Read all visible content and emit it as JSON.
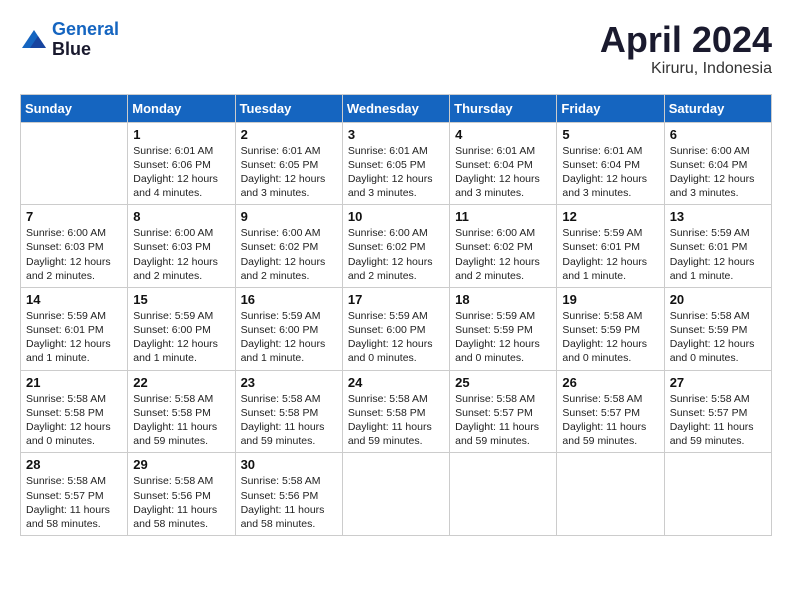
{
  "header": {
    "logo": {
      "line1": "General",
      "line2": "Blue"
    },
    "month": "April 2024",
    "location": "Kiruru, Indonesia"
  },
  "weekdays": [
    "Sunday",
    "Monday",
    "Tuesday",
    "Wednesday",
    "Thursday",
    "Friday",
    "Saturday"
  ],
  "weeks": [
    [
      {
        "day": "",
        "info": ""
      },
      {
        "day": "1",
        "info": "Sunrise: 6:01 AM\nSunset: 6:06 PM\nDaylight: 12 hours\nand 4 minutes."
      },
      {
        "day": "2",
        "info": "Sunrise: 6:01 AM\nSunset: 6:05 PM\nDaylight: 12 hours\nand 3 minutes."
      },
      {
        "day": "3",
        "info": "Sunrise: 6:01 AM\nSunset: 6:05 PM\nDaylight: 12 hours\nand 3 minutes."
      },
      {
        "day": "4",
        "info": "Sunrise: 6:01 AM\nSunset: 6:04 PM\nDaylight: 12 hours\nand 3 minutes."
      },
      {
        "day": "5",
        "info": "Sunrise: 6:01 AM\nSunset: 6:04 PM\nDaylight: 12 hours\nand 3 minutes."
      },
      {
        "day": "6",
        "info": "Sunrise: 6:00 AM\nSunset: 6:04 PM\nDaylight: 12 hours\nand 3 minutes."
      }
    ],
    [
      {
        "day": "7",
        "info": "Sunrise: 6:00 AM\nSunset: 6:03 PM\nDaylight: 12 hours\nand 2 minutes."
      },
      {
        "day": "8",
        "info": "Sunrise: 6:00 AM\nSunset: 6:03 PM\nDaylight: 12 hours\nand 2 minutes."
      },
      {
        "day": "9",
        "info": "Sunrise: 6:00 AM\nSunset: 6:02 PM\nDaylight: 12 hours\nand 2 minutes."
      },
      {
        "day": "10",
        "info": "Sunrise: 6:00 AM\nSunset: 6:02 PM\nDaylight: 12 hours\nand 2 minutes."
      },
      {
        "day": "11",
        "info": "Sunrise: 6:00 AM\nSunset: 6:02 PM\nDaylight: 12 hours\nand 2 minutes."
      },
      {
        "day": "12",
        "info": "Sunrise: 5:59 AM\nSunset: 6:01 PM\nDaylight: 12 hours\nand 1 minute."
      },
      {
        "day": "13",
        "info": "Sunrise: 5:59 AM\nSunset: 6:01 PM\nDaylight: 12 hours\nand 1 minute."
      }
    ],
    [
      {
        "day": "14",
        "info": "Sunrise: 5:59 AM\nSunset: 6:01 PM\nDaylight: 12 hours\nand 1 minute."
      },
      {
        "day": "15",
        "info": "Sunrise: 5:59 AM\nSunset: 6:00 PM\nDaylight: 12 hours\nand 1 minute."
      },
      {
        "day": "16",
        "info": "Sunrise: 5:59 AM\nSunset: 6:00 PM\nDaylight: 12 hours\nand 1 minute."
      },
      {
        "day": "17",
        "info": "Sunrise: 5:59 AM\nSunset: 6:00 PM\nDaylight: 12 hours\nand 0 minutes."
      },
      {
        "day": "18",
        "info": "Sunrise: 5:59 AM\nSunset: 5:59 PM\nDaylight: 12 hours\nand 0 minutes."
      },
      {
        "day": "19",
        "info": "Sunrise: 5:58 AM\nSunset: 5:59 PM\nDaylight: 12 hours\nand 0 minutes."
      },
      {
        "day": "20",
        "info": "Sunrise: 5:58 AM\nSunset: 5:59 PM\nDaylight: 12 hours\nand 0 minutes."
      }
    ],
    [
      {
        "day": "21",
        "info": "Sunrise: 5:58 AM\nSunset: 5:58 PM\nDaylight: 12 hours\nand 0 minutes."
      },
      {
        "day": "22",
        "info": "Sunrise: 5:58 AM\nSunset: 5:58 PM\nDaylight: 11 hours\nand 59 minutes."
      },
      {
        "day": "23",
        "info": "Sunrise: 5:58 AM\nSunset: 5:58 PM\nDaylight: 11 hours\nand 59 minutes."
      },
      {
        "day": "24",
        "info": "Sunrise: 5:58 AM\nSunset: 5:58 PM\nDaylight: 11 hours\nand 59 minutes."
      },
      {
        "day": "25",
        "info": "Sunrise: 5:58 AM\nSunset: 5:57 PM\nDaylight: 11 hours\nand 59 minutes."
      },
      {
        "day": "26",
        "info": "Sunrise: 5:58 AM\nSunset: 5:57 PM\nDaylight: 11 hours\nand 59 minutes."
      },
      {
        "day": "27",
        "info": "Sunrise: 5:58 AM\nSunset: 5:57 PM\nDaylight: 11 hours\nand 59 minutes."
      }
    ],
    [
      {
        "day": "28",
        "info": "Sunrise: 5:58 AM\nSunset: 5:57 PM\nDaylight: 11 hours\nand 58 minutes."
      },
      {
        "day": "29",
        "info": "Sunrise: 5:58 AM\nSunset: 5:56 PM\nDaylight: 11 hours\nand 58 minutes."
      },
      {
        "day": "30",
        "info": "Sunrise: 5:58 AM\nSunset: 5:56 PM\nDaylight: 11 hours\nand 58 minutes."
      },
      {
        "day": "",
        "info": ""
      },
      {
        "day": "",
        "info": ""
      },
      {
        "day": "",
        "info": ""
      },
      {
        "day": "",
        "info": ""
      }
    ]
  ]
}
